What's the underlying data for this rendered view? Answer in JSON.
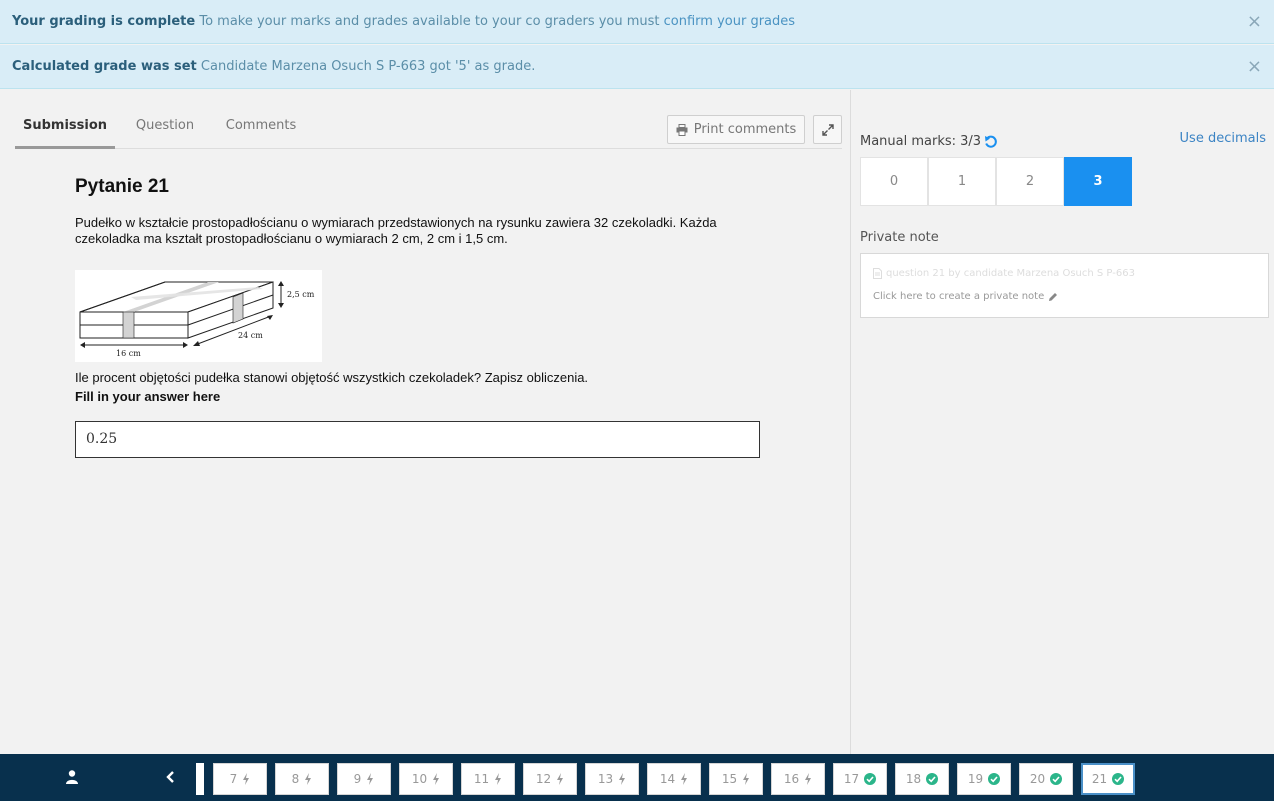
{
  "alerts": [
    {
      "title": "Your grading is complete",
      "message": "To make your marks and grades available to your co graders you must",
      "link": "confirm your grades",
      "close": "×"
    },
    {
      "title": "Calculated grade was set",
      "message": "Candidate Marzena Osuch S P-663 got '5' as grade.",
      "link": "",
      "close": "×"
    }
  ],
  "tabs": [
    "Submission",
    "Question",
    "Comments"
  ],
  "toolbar": {
    "print_label": "Print comments",
    "print_icon": "print-icon",
    "expand_icon": "expand-icon"
  },
  "question": {
    "title": "Pytanie 21",
    "text": "Pudełko w kształcie prostopadłościanu o wymiarach przedstawionych na rysunku zawiera 32 czekoladki. Każda czekoladka ma kształt prostopadłościanu o wymiarach 2 cm, 2 cm i 1,5 cm.",
    "figure_labels": {
      "height": "2,5 cm",
      "depth": "24 cm",
      "width": "16 cm"
    },
    "text2": "Ile procent objętości pudełka stanowi objętość wszystkich czekoladek? Zapisz obliczenia.",
    "fill_label": "Fill in your answer here",
    "answer": "0.25"
  },
  "grading": {
    "marks_label": "Manual marks: 3/3",
    "use_decimals": "Use decimals",
    "options": [
      "0",
      "1",
      "2",
      "3"
    ],
    "selected": "3",
    "private_note_label": "Private note",
    "private_note_meta": "question 21 by candidate Marzena Osuch S P-663",
    "private_note_cta": "Click here to create a private note"
  },
  "nav": {
    "questions": [
      {
        "num": "7",
        "status": "pending"
      },
      {
        "num": "8",
        "status": "pending"
      },
      {
        "num": "9",
        "status": "pending"
      },
      {
        "num": "10",
        "status": "pending"
      },
      {
        "num": "11",
        "status": "pending"
      },
      {
        "num": "12",
        "status": "pending"
      },
      {
        "num": "13",
        "status": "pending"
      },
      {
        "num": "14",
        "status": "pending"
      },
      {
        "num": "15",
        "status": "pending"
      },
      {
        "num": "16",
        "status": "pending"
      },
      {
        "num": "17",
        "status": "done"
      },
      {
        "num": "18",
        "status": "done"
      },
      {
        "num": "19",
        "status": "done"
      },
      {
        "num": "20",
        "status": "done"
      },
      {
        "num": "21",
        "status": "done"
      }
    ],
    "current": "21",
    "colors": {
      "bar": "#08304d",
      "done": "#2bb58a",
      "pending": "#999999",
      "selected": "#1a90f0"
    }
  }
}
